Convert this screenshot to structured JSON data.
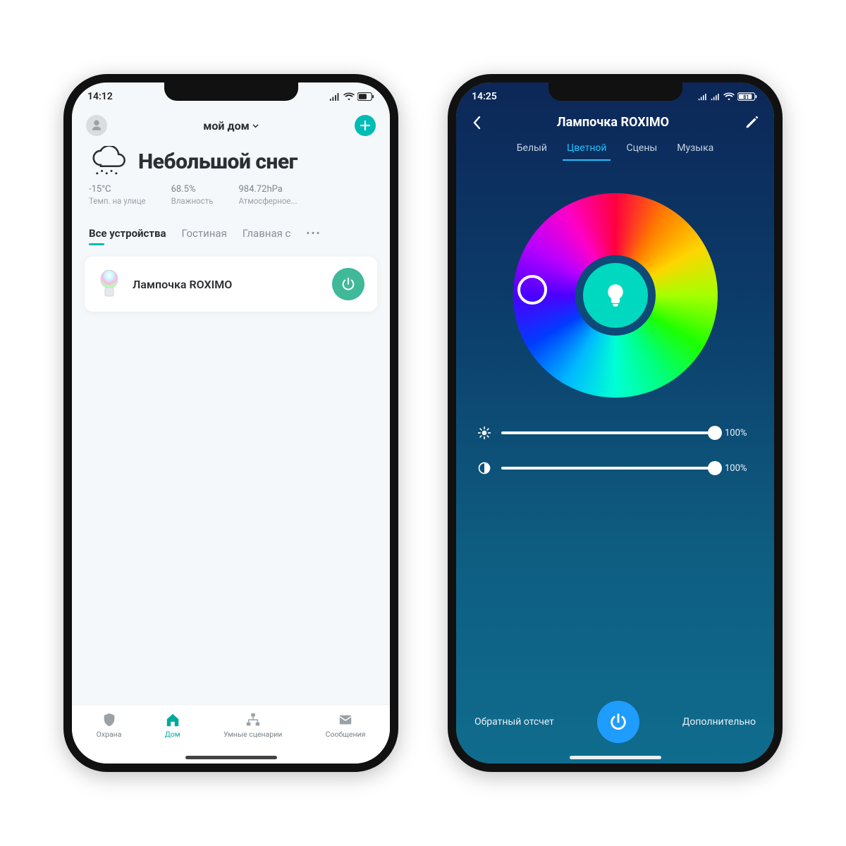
{
  "phone1": {
    "status": {
      "time": "14:12"
    },
    "header": {
      "house": "мой дом"
    },
    "weather": {
      "title": "Небольшой снег",
      "temp": "-15°C",
      "temp_label": "Темп. на улице",
      "humidity": "68.5%",
      "humidity_label": "Влажность",
      "pressure": "984.72hPa",
      "pressure_label": "Атмосферное..."
    },
    "tabs": {
      "t0": "Все устройства",
      "t1": "Гостиная",
      "t2": "Главная с"
    },
    "device": {
      "name": "Лампочка ROXIMO"
    },
    "nav": {
      "n0": "Охрана",
      "n1": "Дом",
      "n2": "Умные сценарии",
      "n3": "Сообщения"
    }
  },
  "phone2": {
    "status": {
      "time": "14:25",
      "battery": "81"
    },
    "header": {
      "title": "Лампочка ROXIMO"
    },
    "modes": {
      "m0": "Белый",
      "m1": "Цветной",
      "m2": "Сцены",
      "m3": "Музыка"
    },
    "sliders": {
      "brightness": "100%",
      "saturation": "100%"
    },
    "bottom": {
      "left": "Обратный отсчет",
      "right": "Дополнительно"
    },
    "colors": {
      "selected": "#00d8c0",
      "power_btn": "#1f9dff"
    }
  }
}
